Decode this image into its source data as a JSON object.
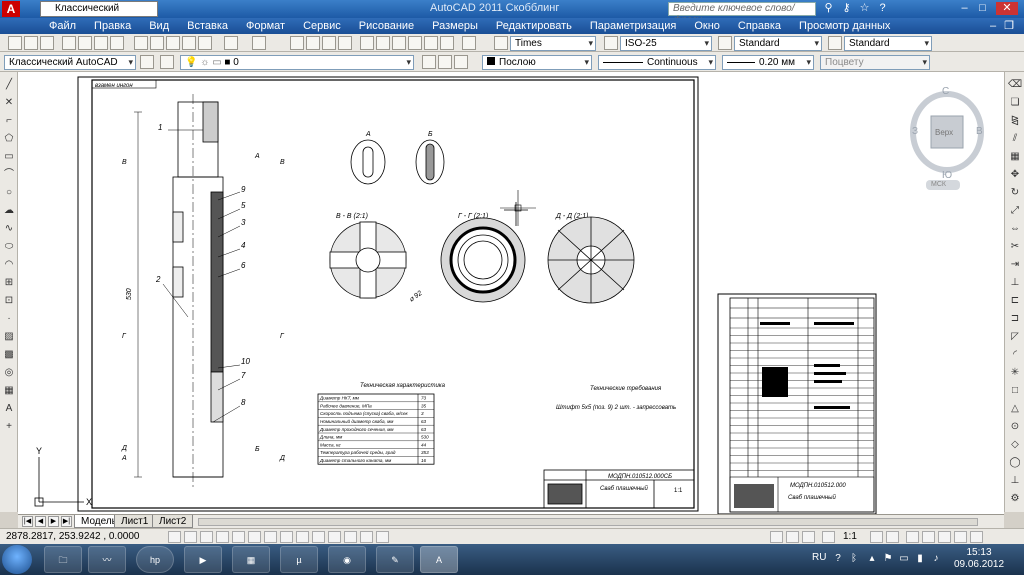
{
  "titlebar": {
    "workspace": "Классический AutoCAD",
    "title": "AutoCAD 2011   Скобблинг",
    "search_placeholder": "Введите ключевое слово/фразу"
  },
  "menu": [
    "Файл",
    "Правка",
    "Вид",
    "Вставка",
    "Формат",
    "Сервис",
    "Рисование",
    "Размеры",
    "Редактировать",
    "Параметризация",
    "Окно",
    "Справка",
    "Просмотр данных"
  ],
  "toolbar1": {
    "text_style": "Times",
    "dim_style": "ISO-25",
    "table_style": "Standard",
    "mleader_style": "Standard"
  },
  "toolbar2": {
    "workspace": "Классический AutoCAD",
    "layer": "0",
    "color": "Послою",
    "linetype": "Continuous",
    "lineweight": "0.20 мм",
    "plotstyle": "Поцвету"
  },
  "viewcube": {
    "top": "Верх",
    "north": "С",
    "south": "Ю",
    "west": "З",
    "east": "В",
    "ucs": "МСК"
  },
  "drawing": {
    "stamp": "взамен ингон",
    "dim_length": "530",
    "dim_diameter": "⌀ 92",
    "sections": [
      "А",
      "Б",
      "В - В (2:1)",
      "Г - Г (2:1)",
      "Д - Д (2:1)"
    ],
    "section_letters": [
      "В",
      "А",
      "В",
      "Г",
      "Г",
      "А",
      "Д",
      "Б",
      "Д"
    ],
    "callouts": [
      "1",
      "2",
      "9",
      "5",
      "3",
      "4",
      "6",
      "10",
      "7",
      "8"
    ],
    "specs_title": "Техническая характеристика",
    "requirements_title": "Технические требования",
    "requirements_text": "Штифт 5х5 (поз. 9) 2 шт. - запрессовать",
    "specs": [
      {
        "name": "Диаметр НКТ, мм",
        "value": "73"
      },
      {
        "name": "Рабочее давление, МПа",
        "value": "35"
      },
      {
        "name": "Скорость подъема (спуска) сваба, м/сек",
        "value": "3"
      },
      {
        "name": "Номинальный диаметр сваба, мм",
        "value": "63"
      },
      {
        "name": "Диаметр проходного сечения, мм",
        "value": "63"
      },
      {
        "name": "Длина, мм",
        "value": "530"
      },
      {
        "name": "Масса, кг",
        "value": "44"
      },
      {
        "name": "Температура рабочей среды, град",
        "value": "353"
      },
      {
        "name": "Диаметр стального каната, мм",
        "value": "16"
      }
    ],
    "title_block": {
      "code": "МОДПН.010512.000СБ",
      "name": "Сваб плашечный",
      "sheet": "1:1"
    },
    "title_block_right": {
      "code": "МОДПН.010512.000",
      "name": "Сваб плашечный"
    }
  },
  "tabs": [
    "Модель",
    "Лист1",
    "Лист2"
  ],
  "status": {
    "coords": "2878.2817, 253.9242 , 0.0000",
    "scale": "1:1"
  },
  "taskbar": {
    "lang": "RU",
    "time": "15:13",
    "date": "09.06.2012",
    "tasks": [
      "explorer",
      "media",
      "hp",
      "doc",
      "excel",
      "utorrent",
      "firefox",
      "paint",
      "autocad"
    ]
  }
}
